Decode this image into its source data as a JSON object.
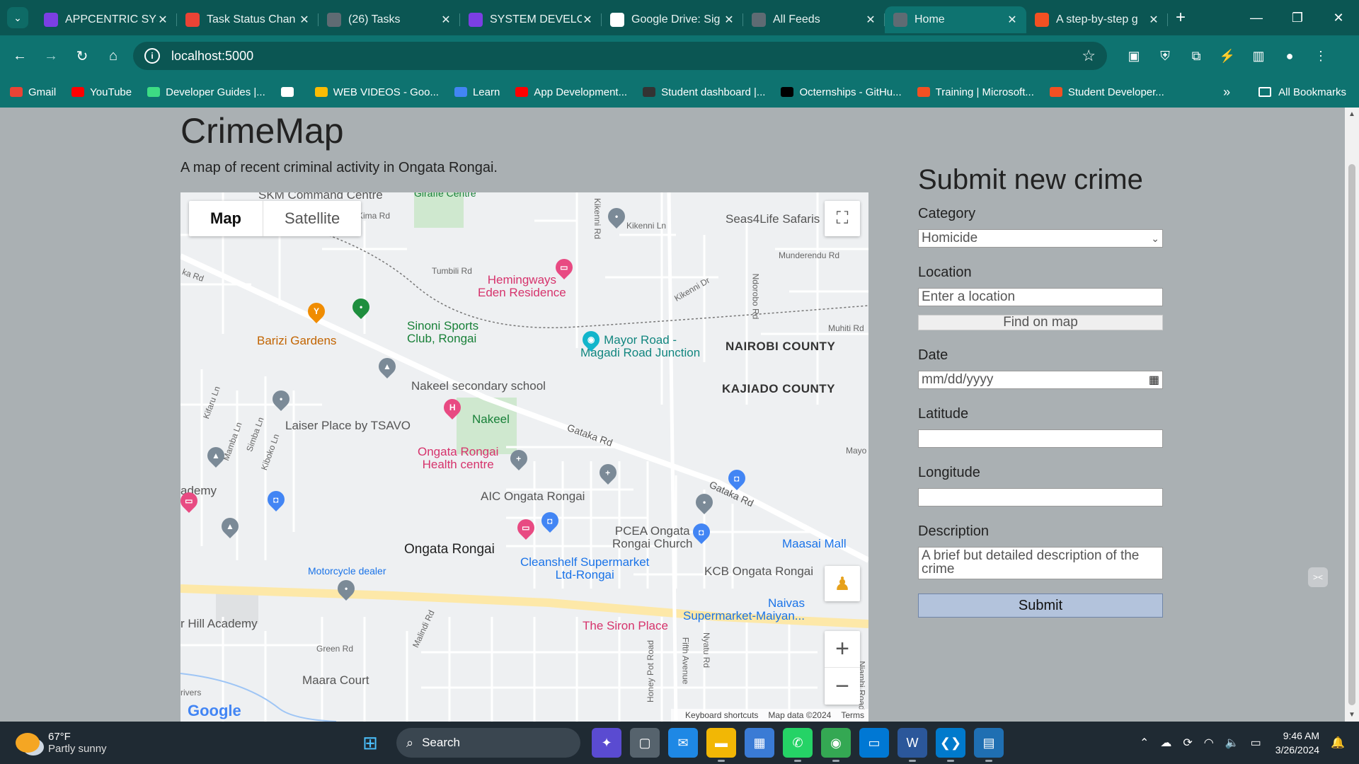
{
  "browser": {
    "tabs": [
      {
        "title": "APPCENTRIC SYS",
        "icon": "list-app-icon",
        "color": "#7b3fe4"
      },
      {
        "title": "Task Status Chan",
        "icon": "gmail-icon",
        "color": "#ea4335"
      },
      {
        "title": "(26) Tasks",
        "icon": "globe-icon",
        "color": "#5f6b73"
      },
      {
        "title": "SYSTEM DEVELO",
        "icon": "list-app-icon",
        "color": "#7b3fe4"
      },
      {
        "title": "Google Drive: Sig",
        "icon": "google-icon",
        "color": "#ffffff"
      },
      {
        "title": "All Feeds",
        "icon": "globe-icon",
        "color": "#5f6b73"
      },
      {
        "title": "Home",
        "icon": "globe-icon",
        "color": "#5f6b73",
        "active": true
      },
      {
        "title": "A step-by-step g",
        "icon": "flame-icon",
        "color": "#f25022"
      }
    ],
    "url": "localhost:5000",
    "bookmarks": [
      {
        "label": "Gmail",
        "color": "#ea4335"
      },
      {
        "label": "YouTube",
        "color": "#ff0000"
      },
      {
        "label": "Developer Guides |...",
        "color": "#3ddc84"
      },
      {
        "label": "",
        "color": "#ffffff"
      },
      {
        "label": "WEB VIDEOS - Goo...",
        "color": "#fbbc04"
      },
      {
        "label": "Learn",
        "color": "#4285f4"
      },
      {
        "label": "App Development...",
        "color": "#ff0000"
      },
      {
        "label": "Student dashboard |...",
        "color": "#333333"
      },
      {
        "label": "Octernships - GitHu...",
        "color": "#000000"
      },
      {
        "label": "Training | Microsoft...",
        "color": "#f25022"
      },
      {
        "label": "Student Developer...",
        "color": "#f25022"
      }
    ],
    "all_bookmarks": "All Bookmarks"
  },
  "page": {
    "title": "CrimeMap",
    "subtitle": "A map of recent criminal activity in Ongata Rongai."
  },
  "map": {
    "type_buttons": [
      "Map",
      "Satellite"
    ],
    "labels": {
      "skm": "SKM Command Centre",
      "giraffe": "Giraffe Centre",
      "kima": "Kima Rd",
      "kikenni_ln": "Kikenni Ln",
      "kikenni_rd": "Kikenni Rd",
      "seas4life": "Seas4Life Safaris",
      "munderendu": "Munderendu Rd",
      "ka_rd": "ka Rd",
      "tumbili": "Tumbili Rd",
      "hemingways": "Hemingways\nEden Residence",
      "kikenni_dr": "Kikenni Dr",
      "ndorobo": "Ndorobo Rd",
      "muhiti": "Muhiti Rd",
      "sinoni": "Sinoni Sports\nClub, Rongai",
      "barizi": "Barizi Gardens",
      "mayor": "Mayor Road -\nMagadi Road Junction",
      "nairobi": "NAIROBI COUNTY",
      "kajiado": "KAJIADO COUNTY",
      "nakeel_school": "Nakeel secondary school",
      "nakeel": "Nakeel",
      "laiser": "Laiser Place by TSAVO",
      "gataka1": "Gataka Rd",
      "gataka2": "Gataka Rd",
      "mayo": "Mayo",
      "health": "Ongata Rongai\nHealth centre",
      "kifaru": "Kifaru Ln",
      "mamba": "Mamba Ln",
      "simba": "Simba Ln",
      "kiboko": "Kiboko Ln",
      "academy": "ademy",
      "aic": "AIC Ongata Rongai",
      "pcea": "PCEA Ongata\nRongai Church",
      "masaai": "Maasai Mall",
      "ongata": "Ongata Rongai",
      "motorcycle": "Motorcycle dealer",
      "cleanshelf": "Cleanshelf Supermarket\nLtd-Rongai",
      "kcb": "KCB Ongata Rongai",
      "hill": "r Hill Academy",
      "malindi": "Malindi Rd",
      "siron": "The Siron Place",
      "naivas": "Naivas\nSupermarket-Maiyan...",
      "green": "Green Rd",
      "honey": "Honey Pot Road",
      "fifth": "Fifth Avenue",
      "nyatu": "Nyatu Rd",
      "njambi": "Njambi Road",
      "maara": "Maara Court",
      "rivers": "rivers"
    },
    "google": "Google",
    "attribution": [
      "Keyboard shortcuts",
      "Map data ©2024",
      "Terms"
    ]
  },
  "form": {
    "heading": "Submit new crime",
    "category_label": "Category",
    "category_value": "Homicide",
    "location_label": "Location",
    "location_placeholder": "Enter a location",
    "find_button": "Find on map",
    "date_label": "Date",
    "date_placeholder": "mm/dd/yyyy",
    "latitude_label": "Latitude",
    "latitude_value": "",
    "longitude_label": "Longitude",
    "longitude_value": "",
    "description_label": "Description",
    "description_placeholder": "A brief but detailed description of the crime",
    "submit_button": "Submit"
  },
  "taskbar": {
    "temp": "67°F",
    "weather": "Partly sunny",
    "search": "Search",
    "time": "9:46 AM",
    "date": "3/26/2024"
  }
}
